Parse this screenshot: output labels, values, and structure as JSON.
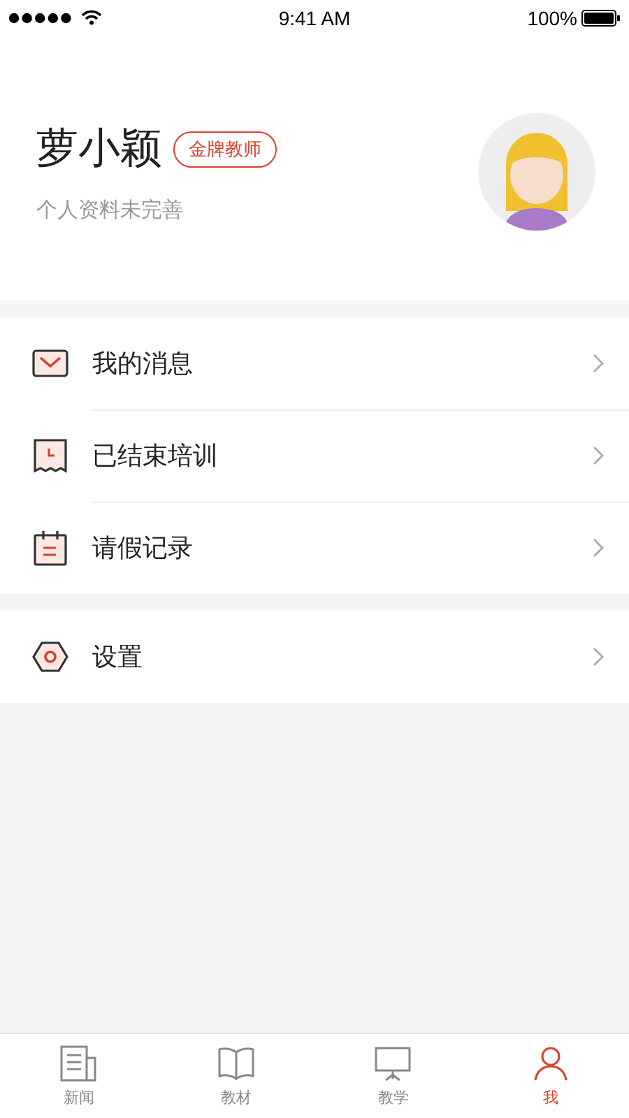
{
  "status_bar": {
    "time": "9:41 AM",
    "battery": "100%"
  },
  "profile": {
    "name": "萝小颖",
    "badge": "金牌教师",
    "subtitle": "个人资料未完善"
  },
  "menu_groups": [
    {
      "items": [
        {
          "label": "我的消息",
          "kind": "mail"
        },
        {
          "label": "已结束培训",
          "kind": "receipt"
        },
        {
          "label": "请假记录",
          "kind": "calendar"
        }
      ]
    },
    {
      "items": [
        {
          "label": "设置",
          "kind": "settings"
        }
      ]
    }
  ],
  "tab_bar": [
    {
      "label": "新闻",
      "kind": "news",
      "selected": false
    },
    {
      "label": "教材",
      "kind": "book",
      "selected": false
    },
    {
      "label": "教学",
      "kind": "teach",
      "selected": false
    },
    {
      "label": "我",
      "kind": "me",
      "selected": true
    }
  ]
}
